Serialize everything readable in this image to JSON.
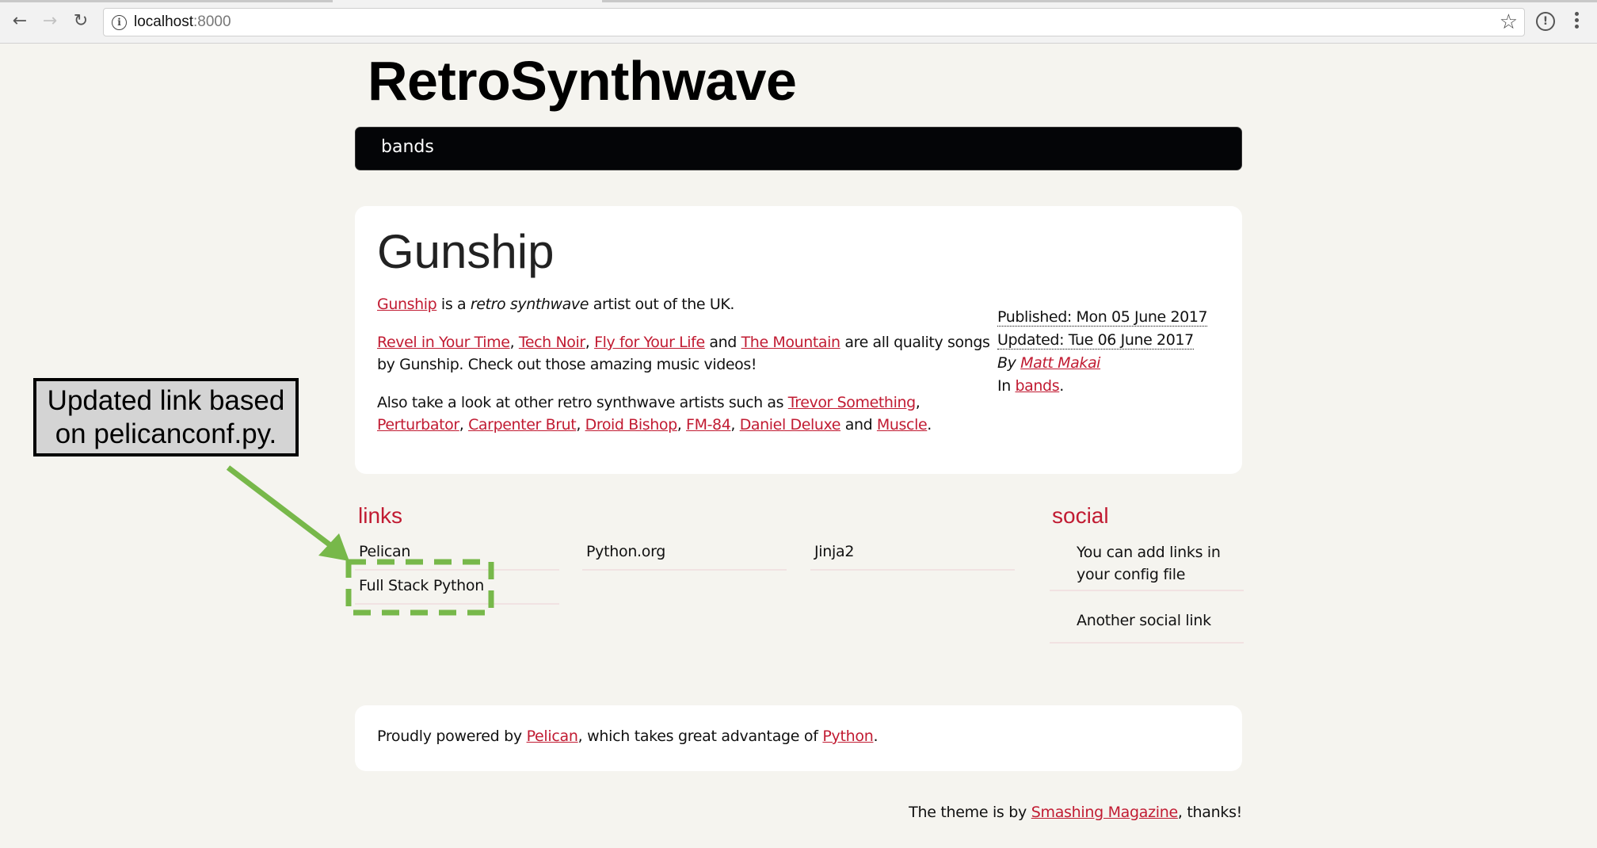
{
  "browser": {
    "url_host": "localhost",
    "url_port": ":8000",
    "icons": {
      "back": "arrow-left-icon",
      "forward": "arrow-right-icon",
      "reload": "reload-icon",
      "site_info": "info-icon",
      "bookmark": "star-icon",
      "extension": "extension-icon",
      "menu": "kebab-menu-icon"
    }
  },
  "site": {
    "title": "RetroSynthwave",
    "nav": [
      {
        "label": "bands"
      }
    ]
  },
  "article": {
    "title": "Gunship",
    "p1": {
      "link": "Gunship",
      "text1": " is a ",
      "em": "retro synthwave",
      "text2": " artist out of the UK."
    },
    "p2": {
      "links": [
        "Revel in Your Time",
        "Tech Noir",
        "Fly for Your Life",
        "The Mountain"
      ],
      "sep1": ", ",
      "sep2": ", ",
      "sep3": " and ",
      "tail": " are all quality songs by Gunship. Check out those amazing music videos!"
    },
    "p3": {
      "lead": "Also take a look at other retro synthwave artists such as ",
      "links": [
        "Trevor Something",
        "Perturbator",
        "Carpenter Brut",
        "Droid Bishop",
        "FM-84",
        "Daniel Deluxe",
        "Muscle"
      ],
      "comma": ", ",
      "and": " and ",
      "end": "."
    },
    "meta": {
      "published": "Published: Mon 05 June 2017",
      "updated": "Updated: Tue 06 June 2017",
      "by_label": "By ",
      "author": "Matt Makai",
      "in_label": "In ",
      "category": "bands",
      "period": "."
    }
  },
  "blogroll": {
    "heading": "links",
    "items": [
      "Pelican",
      "Python.org",
      "Jinja2",
      "Full Stack Python"
    ]
  },
  "social": {
    "heading": "social",
    "items": [
      "You can add links in your config file",
      "Another social link"
    ]
  },
  "footer": {
    "lead": "Proudly powered by ",
    "link1": "Pelican",
    "mid": ", which takes great advantage of ",
    "link2": "Python",
    "end": "."
  },
  "credit": {
    "lead": "The theme is by ",
    "link": "Smashing Magazine",
    "end": ", thanks!"
  },
  "annotation": {
    "line1": "Updated link based",
    "line2": "on pelicanconf.py.",
    "accent": "#77b84a"
  },
  "colors": {
    "link": "#c11b32",
    "nav_bg": "#040507",
    "page_bg": "#f5f4ef"
  }
}
